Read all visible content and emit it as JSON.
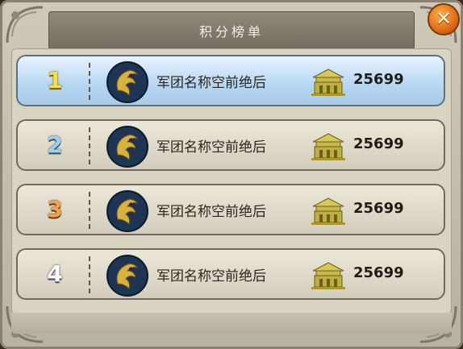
{
  "title": "积分榜单",
  "close": {
    "label": "✕",
    "icon": "close-icon"
  },
  "rows": [
    {
      "rank": "1",
      "rank_color": "#f2df4a",
      "name": "军团名称空前绝后",
      "score": "25699",
      "selected": true
    },
    {
      "rank": "2",
      "rank_color": "#9fd0ec",
      "name": "军团名称空前绝后",
      "score": "25699",
      "selected": false
    },
    {
      "rank": "3",
      "rank_color": "#f0a24e",
      "name": "军团名称空前绝后",
      "score": "25699",
      "selected": false
    },
    {
      "rank": "4",
      "rank_color": "#ffffff",
      "name": "军团名称空前绝后",
      "score": "25699",
      "selected": false
    }
  ],
  "icons": {
    "emblem": "dragon-emblem-icon",
    "score": "palace-score-icon"
  },
  "colors": {
    "selected_row": "#b6d6f1",
    "row": "#e4dfd1",
    "score_icon": "#c8b84a"
  }
}
